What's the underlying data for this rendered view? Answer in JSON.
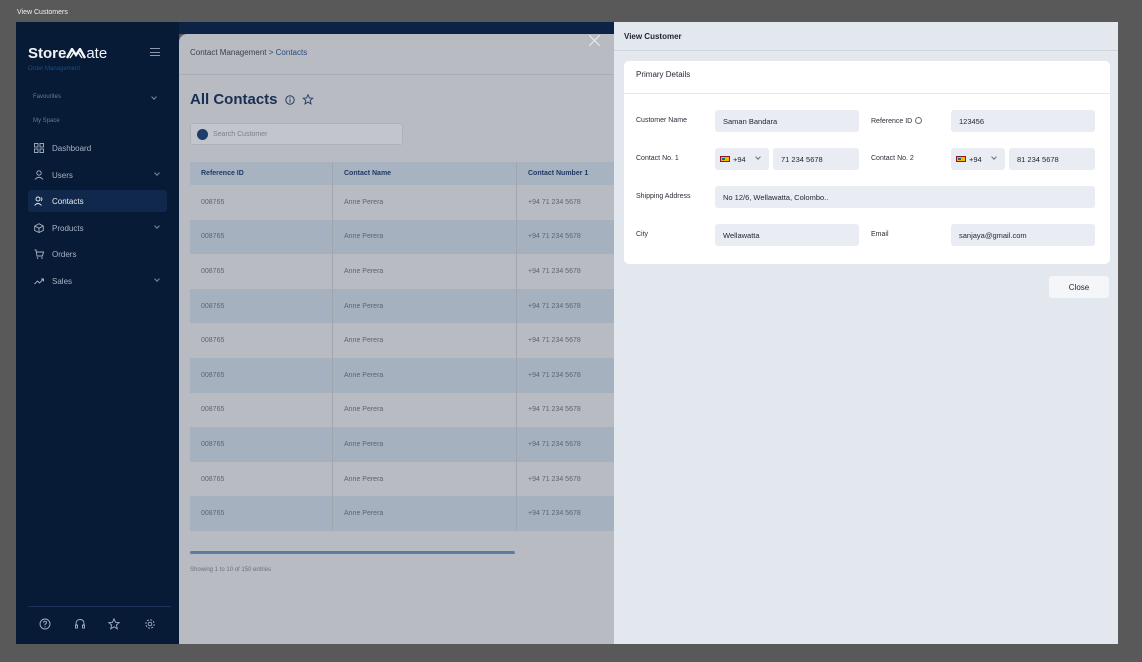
{
  "window": {
    "title": "View Customers"
  },
  "sidebar": {
    "brand_bold": "Store",
    "brand_thin": "ate",
    "brand_sub": "Order Management",
    "sections": {
      "favourites": "Favourites",
      "my_space": "My Space"
    },
    "items": [
      {
        "label": "Dashboard",
        "icon": "dashboard-icon",
        "has_chevron": false,
        "active": false
      },
      {
        "label": "Users",
        "icon": "user-icon",
        "has_chevron": true,
        "active": false
      },
      {
        "label": "Contacts",
        "icon": "contacts-icon",
        "has_chevron": false,
        "active": true
      },
      {
        "label": "Products",
        "icon": "box-icon",
        "has_chevron": true,
        "active": false
      },
      {
        "label": "Orders",
        "icon": "cart-icon",
        "has_chevron": false,
        "active": false
      },
      {
        "label": "Sales",
        "icon": "trend-icon",
        "has_chevron": true,
        "active": false
      }
    ],
    "bottom_icons": [
      "help-icon",
      "headset-icon",
      "star-icon",
      "settings-icon"
    ]
  },
  "main": {
    "breadcrumb": {
      "parent": "Contact Management",
      "separator": ">",
      "current": "Contacts"
    },
    "page_title": "All Contacts",
    "search_placeholder": "Search Customer",
    "table": {
      "columns": [
        "Reference ID",
        "Contact Name",
        "Contact Number 1"
      ],
      "rows": [
        [
          "008765",
          "Anne Perera",
          "+94 71 234 5678"
        ],
        [
          "008765",
          "Anne Perera",
          "+94 71 234 5678"
        ],
        [
          "008765",
          "Anne Perera",
          "+94 71 234 5678"
        ],
        [
          "008765",
          "Anne Perera",
          "+94 71 234 5678"
        ],
        [
          "008765",
          "Anne Perera",
          "+94 71 234 5678"
        ],
        [
          "008765",
          "Anne Perera",
          "+94 71 234 5678"
        ],
        [
          "008765",
          "Anne Perera",
          "+94 71 234 5678"
        ],
        [
          "008765",
          "Anne Perera",
          "+94 71 234 5678"
        ],
        [
          "008765",
          "Anne Perera",
          "+94 71 234 5678"
        ],
        [
          "008765",
          "Anne Perera",
          "+94 71 234 5678"
        ]
      ]
    },
    "showing": "Showing 1 to 10 of 150 entries"
  },
  "drawer": {
    "title": "View Customer",
    "section_title": "Primary Details",
    "fields": {
      "customer_name": {
        "label": "Customer Name",
        "value": "Saman Bandara"
      },
      "reference_id": {
        "label": "Reference ID",
        "value": "123456"
      },
      "contact_no_1": {
        "label": "Contact No. 1",
        "code": "+94",
        "value": "71 234 5678"
      },
      "contact_no_2": {
        "label": "Contact No. 2",
        "code": "+94",
        "value": "81 234 5678"
      },
      "shipping_address": {
        "label": "Shipping Address",
        "value": "No 12/6, Wellawatta, Colombo.."
      },
      "city": {
        "label": "City",
        "value": "Wellawatta"
      },
      "email": {
        "label": "Email",
        "value": "sanjaya@gmail.com"
      }
    },
    "close_label": "Close"
  },
  "colors": {
    "sidebar_bg": "#071a36",
    "accent": "#1d3d6c",
    "drawer_bg": "#e3e8ef",
    "overlay": "#595959"
  }
}
